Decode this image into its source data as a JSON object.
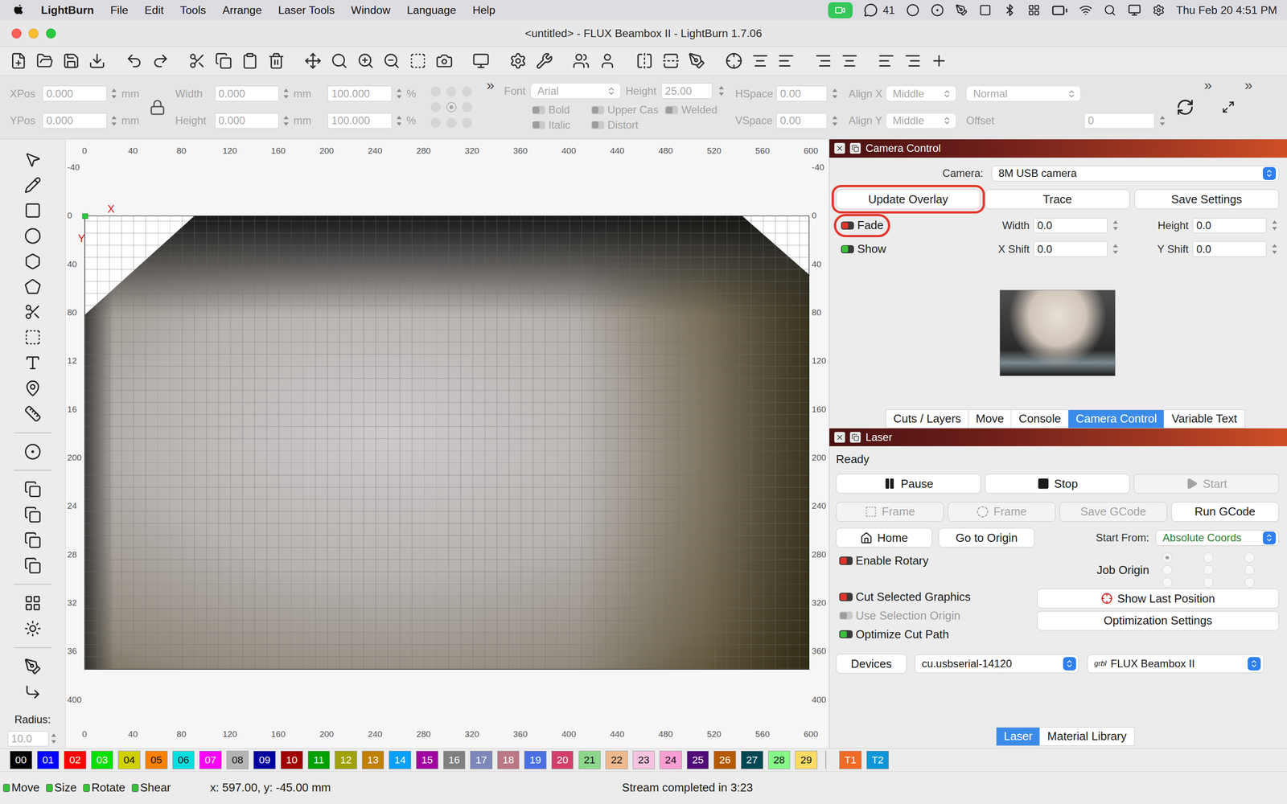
{
  "menubar": {
    "app": "LightBurn",
    "items": [
      "File",
      "Edit",
      "Tools",
      "Arrange",
      "Laser Tools",
      "Window",
      "Language",
      "Help"
    ],
    "chat_badge": "41",
    "clock": "Thu Feb 20  4:51 PM"
  },
  "window": {
    "title": "<untitled> - FLUX Beambox II - LightBurn 1.7.06"
  },
  "numeric_toolbar": {
    "disabled": true,
    "position": [
      {
        "label": "XPos",
        "value": "0.000",
        "unit": "mm"
      },
      {
        "label": "YPos",
        "value": "0.000",
        "unit": "mm"
      }
    ],
    "size": [
      {
        "label": "Width",
        "value": "0.000",
        "unit": "mm",
        "scale": "100.000",
        "scale_unit": "%"
      },
      {
        "label": "Height",
        "value": "0.000",
        "unit": "mm",
        "scale": "100.000",
        "scale_unit": "%"
      }
    ],
    "anchor_points": [
      {
        "selected": false
      },
      {
        "selected": false
      },
      {
        "selected": false
      },
      {
        "selected": false
      },
      {
        "selected": true
      },
      {
        "selected": false
      },
      {
        "selected": false
      },
      {
        "selected": false
      },
      {
        "selected": false
      }
    ],
    "overflow": [
      "»",
      "»",
      "»"
    ]
  },
  "text_tools": {
    "disabled": true,
    "font": {
      "label": "Font",
      "value": "Arial",
      "height_label": "Height",
      "height": "25.00"
    },
    "styles": [
      {
        "label": "Bold",
        "on": false
      },
      {
        "label": "Upper Cas",
        "on": false
      },
      {
        "label": "Welded",
        "on": false
      },
      {
        "label": "Italic",
        "on": false
      },
      {
        "label": "Distort",
        "on": false
      }
    ],
    "spacing": [
      {
        "label": "HSpace",
        "value": "0.00"
      },
      {
        "label": "VSpace",
        "value": "0.00"
      }
    ],
    "align": [
      {
        "label": "Align X",
        "value": "Middle"
      },
      {
        "label": "Align Y",
        "value": "Middle"
      }
    ],
    "mode": "Normal",
    "offset": {
      "label": "Offset",
      "value": "0"
    }
  },
  "canvas": {
    "rulers": {
      "top": [
        "0",
        "40",
        "80",
        "120",
        "160",
        "200",
        "240",
        "280",
        "320",
        "360",
        "400",
        "440",
        "480",
        "520",
        "560",
        "600"
      ],
      "bottom": [
        "0",
        "40",
        "80",
        "120",
        "160",
        "200",
        "240",
        "280",
        "320",
        "360",
        "400",
        "440",
        "480",
        "520",
        "560",
        "600"
      ],
      "left": [
        "-40",
        "0",
        "40",
        "80",
        "12",
        "16",
        "200",
        "24",
        "28",
        "32",
        "36",
        "400"
      ],
      "right": [
        "-40",
        "0",
        "40",
        "80",
        "120",
        "160",
        "200",
        "240",
        "280",
        "320",
        "360",
        "400"
      ]
    },
    "axis_labels": {
      "x": "X",
      "y": "Y"
    },
    "overlay": {
      "shown": true,
      "faded": false
    }
  },
  "left_tools": {
    "radius_label": "Radius:",
    "radius": "10.0"
  },
  "camera_panel": {
    "title": "Camera Control",
    "camera_label": "Camera:",
    "camera": "8M USB camera",
    "buttons": [
      {
        "label": "Update Overlay",
        "highlighted": true
      },
      {
        "label": "Trace",
        "highlighted": false
      },
      {
        "label": "Save Settings",
        "highlighted": false
      }
    ],
    "toggles": [
      {
        "label": "Fade",
        "on": false,
        "highlighted": true
      },
      {
        "label": "Show",
        "on": true,
        "highlighted": false
      }
    ],
    "fields": [
      {
        "label": "Width",
        "value": "0.0"
      },
      {
        "label": "Height",
        "value": "0.0"
      },
      {
        "label": "X Shift",
        "value": "0.0"
      },
      {
        "label": "Y Shift",
        "value": "0.0"
      }
    ]
  },
  "dock_tabs": [
    {
      "label": "Cuts / Layers",
      "selected": false
    },
    {
      "label": "Move",
      "selected": false
    },
    {
      "label": "Console",
      "selected": false
    },
    {
      "label": "Camera Control",
      "selected": true
    },
    {
      "label": "Variable Text",
      "selected": false
    }
  ],
  "laser_panel": {
    "title": "Laser",
    "status": "Ready",
    "controls": [
      {
        "label": "Pause",
        "kind": "pause",
        "disabled": false
      },
      {
        "label": "Stop",
        "kind": "stop",
        "disabled": false
      },
      {
        "label": "Start",
        "kind": "start",
        "disabled": true
      }
    ],
    "frame_row": [
      {
        "label": "Frame",
        "kind": "frame-rect",
        "disabled": true
      },
      {
        "label": "Frame",
        "kind": "frame-circle",
        "disabled": true
      },
      {
        "label": "Save GCode",
        "kind": "plain",
        "disabled": true
      },
      {
        "label": "Run GCode",
        "kind": "plain",
        "disabled": false
      }
    ],
    "home": "Home",
    "go_to_origin": "Go to Origin",
    "start_from": {
      "label": "Start From:",
      "value": "Absolute Coords"
    },
    "options": [
      {
        "label": "Enable Rotary",
        "on": false,
        "disabled": false
      },
      {
        "label": "Cut Selected Graphics",
        "on": false,
        "disabled": false
      },
      {
        "label": "Use Selection Origin",
        "on": false,
        "disabled": true
      },
      {
        "label": "Optimize Cut Path",
        "on": true,
        "disabled": false
      }
    ],
    "job_origin": {
      "label": "Job Origin",
      "disabled": true,
      "points": [
        {
          "selected": true
        },
        {
          "selected": false
        },
        {
          "selected": false
        },
        {
          "selected": false
        },
        {
          "selected": false
        },
        {
          "selected": false
        },
        {
          "selected": false
        },
        {
          "selected": false
        },
        {
          "selected": false
        }
      ]
    },
    "show_last_position": "Show Last Position",
    "optimization_settings": "Optimization Settings",
    "devices": "Devices",
    "port": "cu.usbserial-14120",
    "device": {
      "prefix": "grbl",
      "name": "FLUX Beambox II"
    }
  },
  "bottom_tabs": [
    {
      "label": "Laser",
      "selected": true
    },
    {
      "label": "Material Library",
      "selected": false
    }
  ],
  "palette": [
    {
      "label": "00",
      "color": "#000000",
      "kind": "layer"
    },
    {
      "label": "01",
      "color": "#0000ff",
      "kind": "layer"
    },
    {
      "label": "02",
      "color": "#ff0000",
      "kind": "layer"
    },
    {
      "label": "03",
      "color": "#00e000",
      "kind": "layer"
    },
    {
      "label": "04",
      "color": "#d0d000",
      "kind": "layer"
    },
    {
      "label": "05",
      "color": "#ff8000",
      "kind": "layer"
    },
    {
      "label": "06",
      "color": "#00e0e0",
      "kind": "layer"
    },
    {
      "label": "07",
      "color": "#ff00ff",
      "kind": "layer"
    },
    {
      "label": "08",
      "color": "#b4b4b4",
      "kind": "layer"
    },
    {
      "label": "09",
      "color": "#0000a0",
      "kind": "layer"
    },
    {
      "label": "10",
      "color": "#a00000",
      "kind": "layer"
    },
    {
      "label": "11",
      "color": "#00a000",
      "kind": "layer"
    },
    {
      "label": "12",
      "color": "#a0a000",
      "kind": "layer"
    },
    {
      "label": "13",
      "color": "#c08000",
      "kind": "layer"
    },
    {
      "label": "14",
      "color": "#00a0ff",
      "kind": "layer"
    },
    {
      "label": "15",
      "color": "#a000a0",
      "kind": "layer"
    },
    {
      "label": "16",
      "color": "#808080",
      "kind": "layer"
    },
    {
      "label": "17",
      "color": "#7d87b9",
      "kind": "layer"
    },
    {
      "label": "18",
      "color": "#bb7784",
      "kind": "layer"
    },
    {
      "label": "19",
      "color": "#4a6fe3",
      "kind": "layer"
    },
    {
      "label": "20",
      "color": "#d33f6a",
      "kind": "layer"
    },
    {
      "label": "21",
      "color": "#8cd78c",
      "kind": "layer"
    },
    {
      "label": "22",
      "color": "#f0b98d",
      "kind": "layer"
    },
    {
      "label": "23",
      "color": "#f6c4e1",
      "kind": "layer"
    },
    {
      "label": "24",
      "color": "#fa9ed4",
      "kind": "layer"
    },
    {
      "label": "25",
      "color": "#500a78",
      "kind": "layer"
    },
    {
      "label": "26",
      "color": "#b45a00",
      "kind": "layer"
    },
    {
      "label": "27",
      "color": "#004754",
      "kind": "layer"
    },
    {
      "label": "28",
      "color": "#86fa88",
      "kind": "layer"
    },
    {
      "label": "29",
      "color": "#ffdb66",
      "kind": "layer"
    },
    {
      "label": "T1",
      "color": "#f36926",
      "kind": "tool"
    },
    {
      "label": "T2",
      "color": "#0c96d9",
      "kind": "tool"
    }
  ],
  "status_bar": {
    "modes": [
      {
        "label": "Move",
        "on": true
      },
      {
        "label": "Size",
        "on": true
      },
      {
        "label": "Rotate",
        "on": true
      },
      {
        "label": "Shear",
        "on": true
      }
    ],
    "coords": "x: 597.00, y: -45.00 mm",
    "message": "Stream completed in 3:23"
  }
}
